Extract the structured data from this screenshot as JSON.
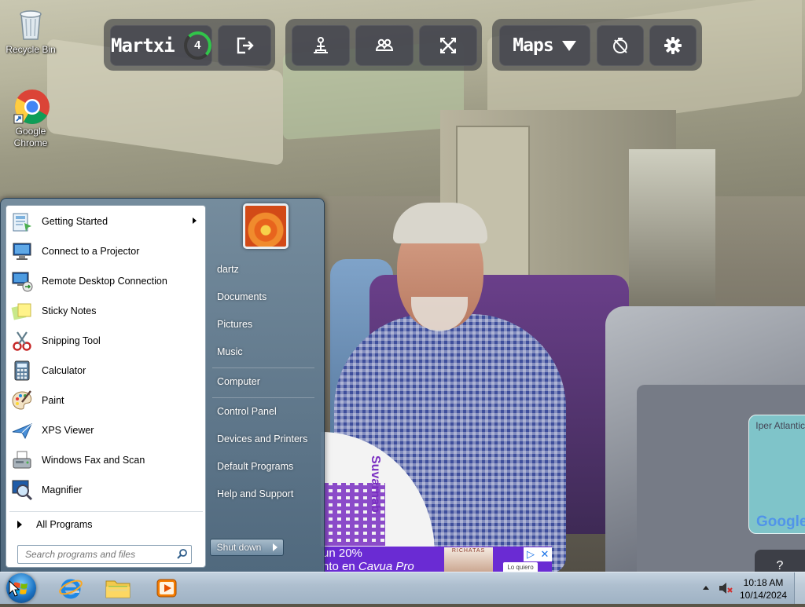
{
  "desktop": {
    "icons": [
      {
        "label": "Recycle Bin",
        "icon": "recycle-bin-icon"
      },
      {
        "label": "Google Chrome",
        "icon": "chrome-icon"
      }
    ]
  },
  "toolbar": {
    "username": "Martxi",
    "badge_count": "4",
    "maps_label": "Maps",
    "buttons": [
      "logout-icon",
      "person-pin-icon",
      "group-icon",
      "cross-arrows-icon",
      "compass-off-icon",
      "gear-icon"
    ],
    "colors": {
      "group_bg": "#282a32",
      "button_bg": "#464850",
      "badge_ring": "#31c44a"
    }
  },
  "background": {
    "qr_text": "Suvarnab",
    "map_text": "Iper Atlantic",
    "map_logo": "Google",
    "help_label": "?",
    "ad": {
      "line1": "un 20%",
      "line2_pre": "nto en ",
      "line2_em": "Cavua Pro",
      "image_label": "RICHATAS",
      "cta": "Lo quiero",
      "info": "▷",
      "close": "✕",
      "color": "#6a2bd3"
    }
  },
  "start_menu": {
    "programs": [
      {
        "label": "Getting Started",
        "icon": "getting-started-icon",
        "submenu": true
      },
      {
        "label": "Connect to a Projector",
        "icon": "projector-icon"
      },
      {
        "label": "Remote Desktop Connection",
        "icon": "remote-desktop-icon"
      },
      {
        "label": "Sticky Notes",
        "icon": "sticky-notes-icon"
      },
      {
        "label": "Snipping Tool",
        "icon": "snipping-tool-icon"
      },
      {
        "label": "Calculator",
        "icon": "calculator-icon"
      },
      {
        "label": "Paint",
        "icon": "paint-icon"
      },
      {
        "label": "XPS Viewer",
        "icon": "xps-viewer-icon"
      },
      {
        "label": "Windows Fax and Scan",
        "icon": "fax-scan-icon"
      },
      {
        "label": "Magnifier",
        "icon": "magnifier-icon"
      }
    ],
    "all_programs": "All Programs",
    "search_placeholder": "Search programs and files",
    "right_links": [
      "dartz",
      "Documents",
      "Pictures",
      "Music",
      "Computer",
      "Control Panel",
      "Devices and Printers",
      "Default Programs",
      "Help and Support"
    ],
    "shutdown_label": "Shut down"
  },
  "taskbar": {
    "apps": [
      "internet-explorer-icon",
      "file-explorer-icon",
      "media-player-icon"
    ],
    "time": "10:18 AM",
    "date": "10/14/2024"
  }
}
